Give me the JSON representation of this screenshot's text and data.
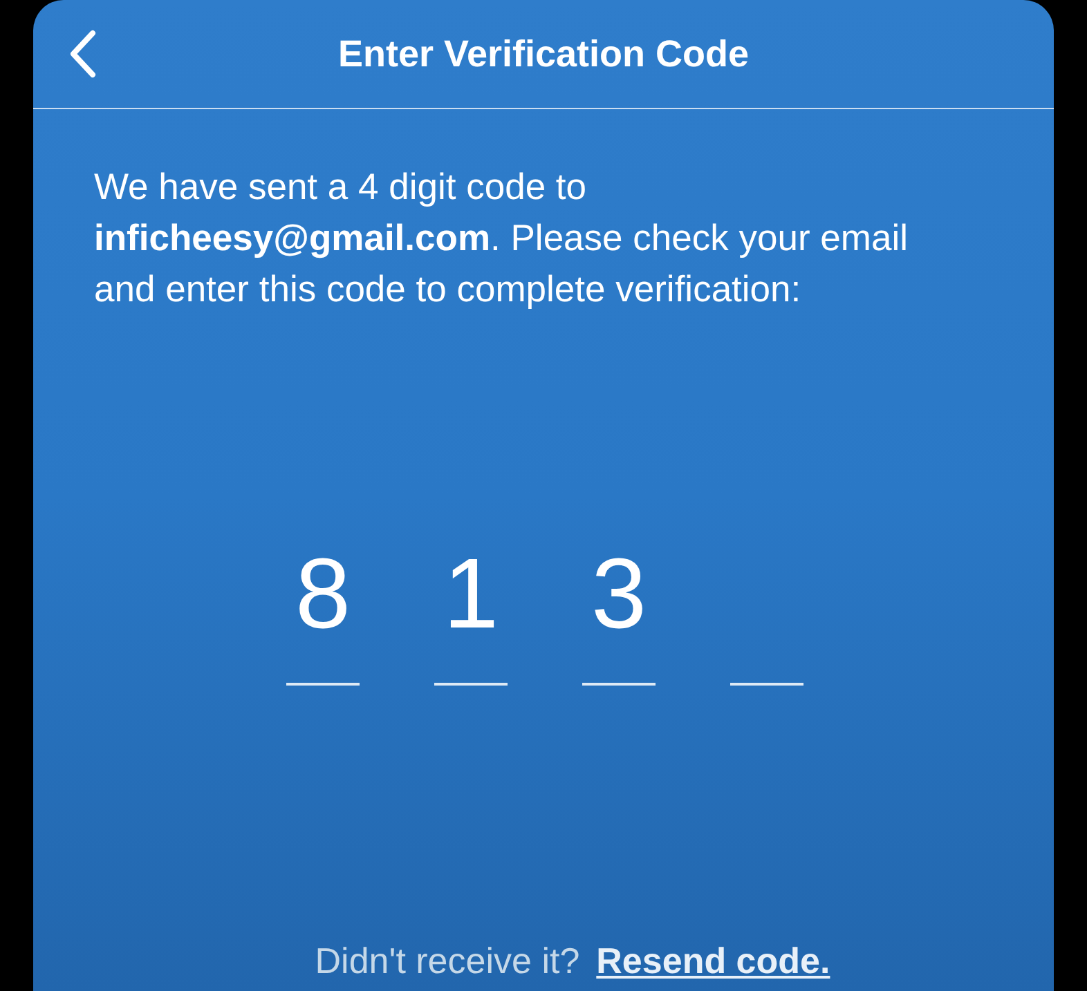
{
  "header": {
    "title": "Enter Verification Code"
  },
  "message": "We have sent a 4 digit code to **inficheesy@gmail.com**. Please check your email and enter this code to complete verification:",
  "code_slots": [
    {
      "kind": "digit",
      "digit": "8"
    },
    {
      "kind": "digit",
      "digit": "1"
    },
    {
      "kind": "digit",
      "digit": "3"
    },
    {
      "kind": "empty"
    }
  ],
  "footer": {
    "prompt": "Didn't receive it?",
    "link": "Resend code."
  }
}
